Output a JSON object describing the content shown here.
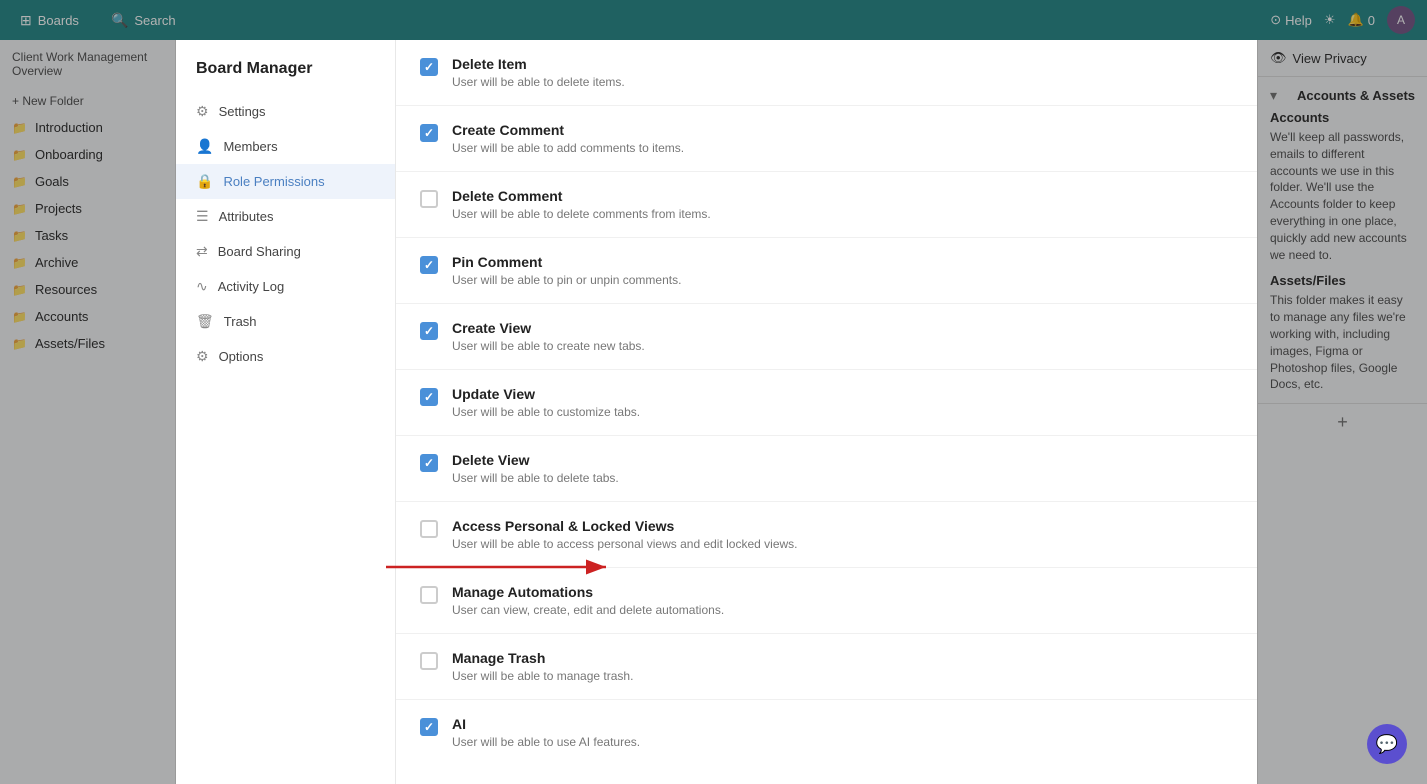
{
  "topbar": {
    "boards_label": "Boards",
    "search_label": "Search",
    "help_label": "Help",
    "notifications_count": "0",
    "boards_icon": "⊞",
    "search_icon": "🔍",
    "help_icon": "⊙",
    "sun_icon": "☀"
  },
  "sidebar": {
    "new_folder_label": "+ New Folder",
    "client_work": "Client Work Management Overview",
    "items": [
      {
        "label": "Introduction",
        "icon": "📁"
      },
      {
        "label": "Onboarding",
        "icon": "📁"
      },
      {
        "label": "Goals",
        "icon": "📁"
      },
      {
        "label": "Projects",
        "icon": "📁"
      },
      {
        "label": "Tasks",
        "icon": "📁"
      },
      {
        "label": "Archive",
        "icon": "📁"
      },
      {
        "label": "Resources",
        "icon": "📁"
      },
      {
        "label": "Accounts",
        "icon": "📁"
      },
      {
        "label": "Assets/Files",
        "icon": "📁"
      }
    ]
  },
  "right_panel": {
    "view_privacy_label": "View Privacy",
    "accounts_section": {
      "title": "Accounts & Assets",
      "accounts_title": "Accounts",
      "accounts_text": "We'll keep all passwords, emails to different accounts we use in this folder. We'll use the Accounts folder to keep everything in one place, quickly add new accounts we need to.",
      "assets_title": "Assets/Files",
      "assets_text": "This folder makes it easy to manage any files we're working with, including images, Figma or Photoshop files, Google Docs, etc."
    }
  },
  "board_manager": {
    "title": "Board Manager",
    "menu_items": [
      {
        "label": "Settings",
        "icon": "⚙",
        "id": "settings"
      },
      {
        "label": "Members",
        "icon": "👤",
        "id": "members"
      },
      {
        "label": "Role Permissions",
        "icon": "🔒",
        "id": "role-permissions",
        "active": true
      },
      {
        "label": "Attributes",
        "icon": "☰",
        "id": "attributes"
      },
      {
        "label": "Board Sharing",
        "icon": "⇄",
        "id": "board-sharing"
      },
      {
        "label": "Activity Log",
        "icon": "〜",
        "id": "activity-log"
      },
      {
        "label": "Trash",
        "icon": "🗑",
        "id": "trash"
      },
      {
        "label": "Options",
        "icon": "⚙",
        "id": "options"
      }
    ],
    "permissions": [
      {
        "title": "Delete Item",
        "desc": "User will be able to delete items.",
        "checked": true
      },
      {
        "title": "Create Comment",
        "desc": "User will be able to add comments to items.",
        "checked": true
      },
      {
        "title": "Delete Comment",
        "desc": "User will be able to delete comments from items.",
        "checked": false
      },
      {
        "title": "Pin Comment",
        "desc": "User will be able to pin or unpin comments.",
        "checked": true
      },
      {
        "title": "Create View",
        "desc": "User will be able to create new tabs.",
        "checked": true
      },
      {
        "title": "Update View",
        "desc": "User will be able to customize tabs.",
        "checked": true
      },
      {
        "title": "Delete View",
        "desc": "User will be able to delete tabs.",
        "checked": true
      },
      {
        "title": "Access Personal & Locked Views",
        "desc": "User will be able to access personal views and edit locked views.",
        "checked": false
      },
      {
        "title": "Manage Automations",
        "desc": "User can view, create, edit and delete automations.",
        "checked": false
      },
      {
        "title": "Manage Trash",
        "desc": "User will be able to manage trash.",
        "checked": false
      },
      {
        "title": "AI",
        "desc": "User will be able to use AI features.",
        "checked": true
      }
    ]
  },
  "chat": {
    "icon": "💬"
  }
}
